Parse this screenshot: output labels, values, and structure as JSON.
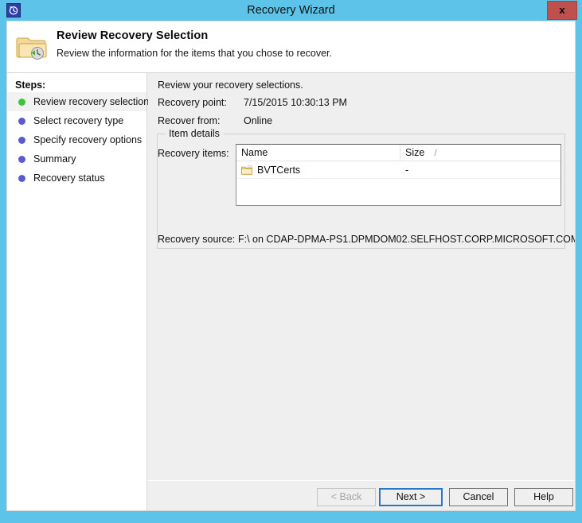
{
  "window": {
    "title": "Recovery Wizard",
    "app_icon": "recovery-clock-icon",
    "close_label": "x",
    "chrome_color": "#5ec3e8",
    "close_button_color": "#c0504d"
  },
  "banner": {
    "icon": "folder-recovery-icon",
    "title": "Review Recovery Selection",
    "subtitle": "Review the information for the items that you chose to recover."
  },
  "sidebar": {
    "heading": "Steps:",
    "active_bullet_color": "#3fc43f",
    "inactive_bullet_color": "#5b5bd0",
    "items": [
      {
        "label": "Review recovery selection",
        "state": "active"
      },
      {
        "label": "Select recovery type",
        "state": "pending"
      },
      {
        "label": "Specify recovery options",
        "state": "pending"
      },
      {
        "label": "Summary",
        "state": "pending"
      },
      {
        "label": "Recovery status",
        "state": "pending"
      }
    ]
  },
  "main": {
    "intro": "Review your recovery selections.",
    "fields": [
      {
        "label": "Recovery point:",
        "value": "7/15/2015 10:30:13 PM"
      },
      {
        "label": "Recover from:",
        "value": "Online"
      }
    ],
    "recovery_point_label": "Recovery point:",
    "recovery_point_value": "7/15/2015 10:30:13 PM",
    "recover_from_label": "Recover from:",
    "recover_from_value": "Online",
    "group": {
      "legend": "Item details",
      "items_label": "Recovery items:",
      "table": {
        "columns": [
          {
            "key": "name",
            "label": "Name"
          },
          {
            "key": "size",
            "label": "Size",
            "sort_indicator": "/"
          }
        ],
        "rows": [
          {
            "icon": "folder-icon",
            "name": "BVTCerts",
            "size": "-"
          }
        ]
      },
      "source_label": "Recovery source:",
      "source_value": "F:\\ on CDAP-DPMA-PS1.DPMDOM02.SELFHOST.CORP.MICROSOFT.COM"
    }
  },
  "footer": {
    "back_label": "< Back",
    "next_label": "Next >",
    "cancel_label": "Cancel",
    "help_label": "Help",
    "back_enabled": false,
    "default_button": "Next >",
    "focus_color": "#2a76c6"
  }
}
